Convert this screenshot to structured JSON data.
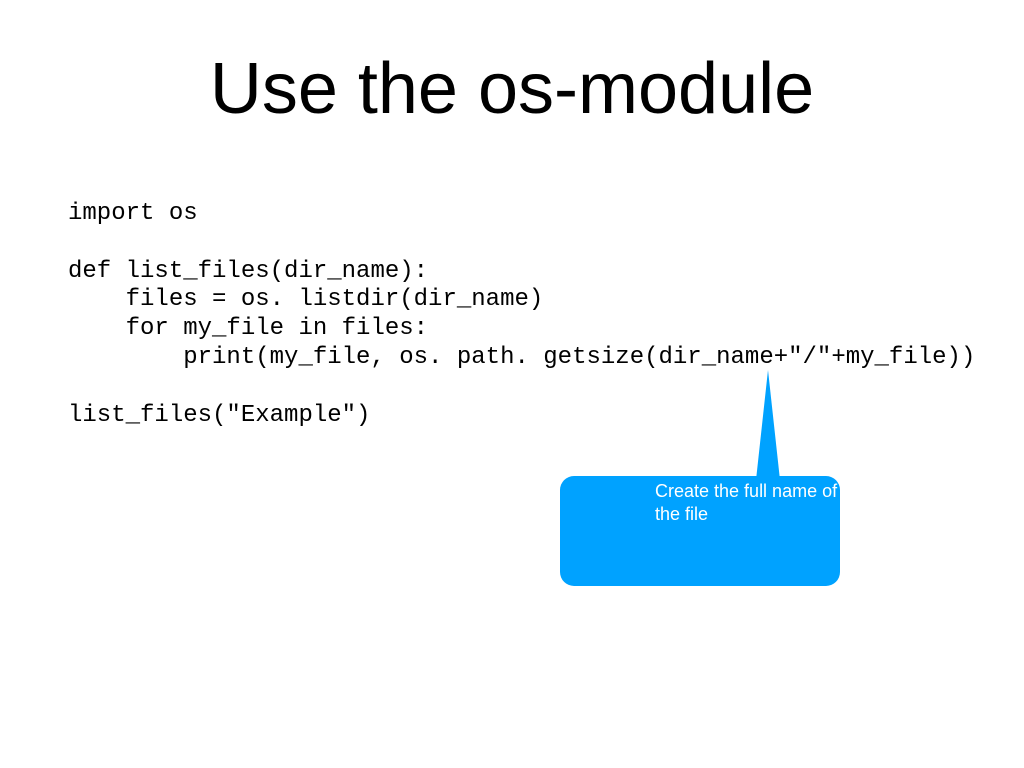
{
  "title": "Use the os-module",
  "code": {
    "line1": "import os",
    "line2": "",
    "line3": "def list_files(dir_name):",
    "line4": "    files = os. listdir(dir_name)",
    "line5": "    for my_file in files:",
    "line6": "        print(my_file, os. path. getsize(dir_name+\"/\"+my_file))",
    "line7": "",
    "line8": "list_files(\"Example\")"
  },
  "callout": {
    "line1": "Create the full name of",
    "line2": "the file"
  },
  "colors": {
    "callout_bg": "#00a2ff",
    "callout_text": "#ffffff"
  }
}
